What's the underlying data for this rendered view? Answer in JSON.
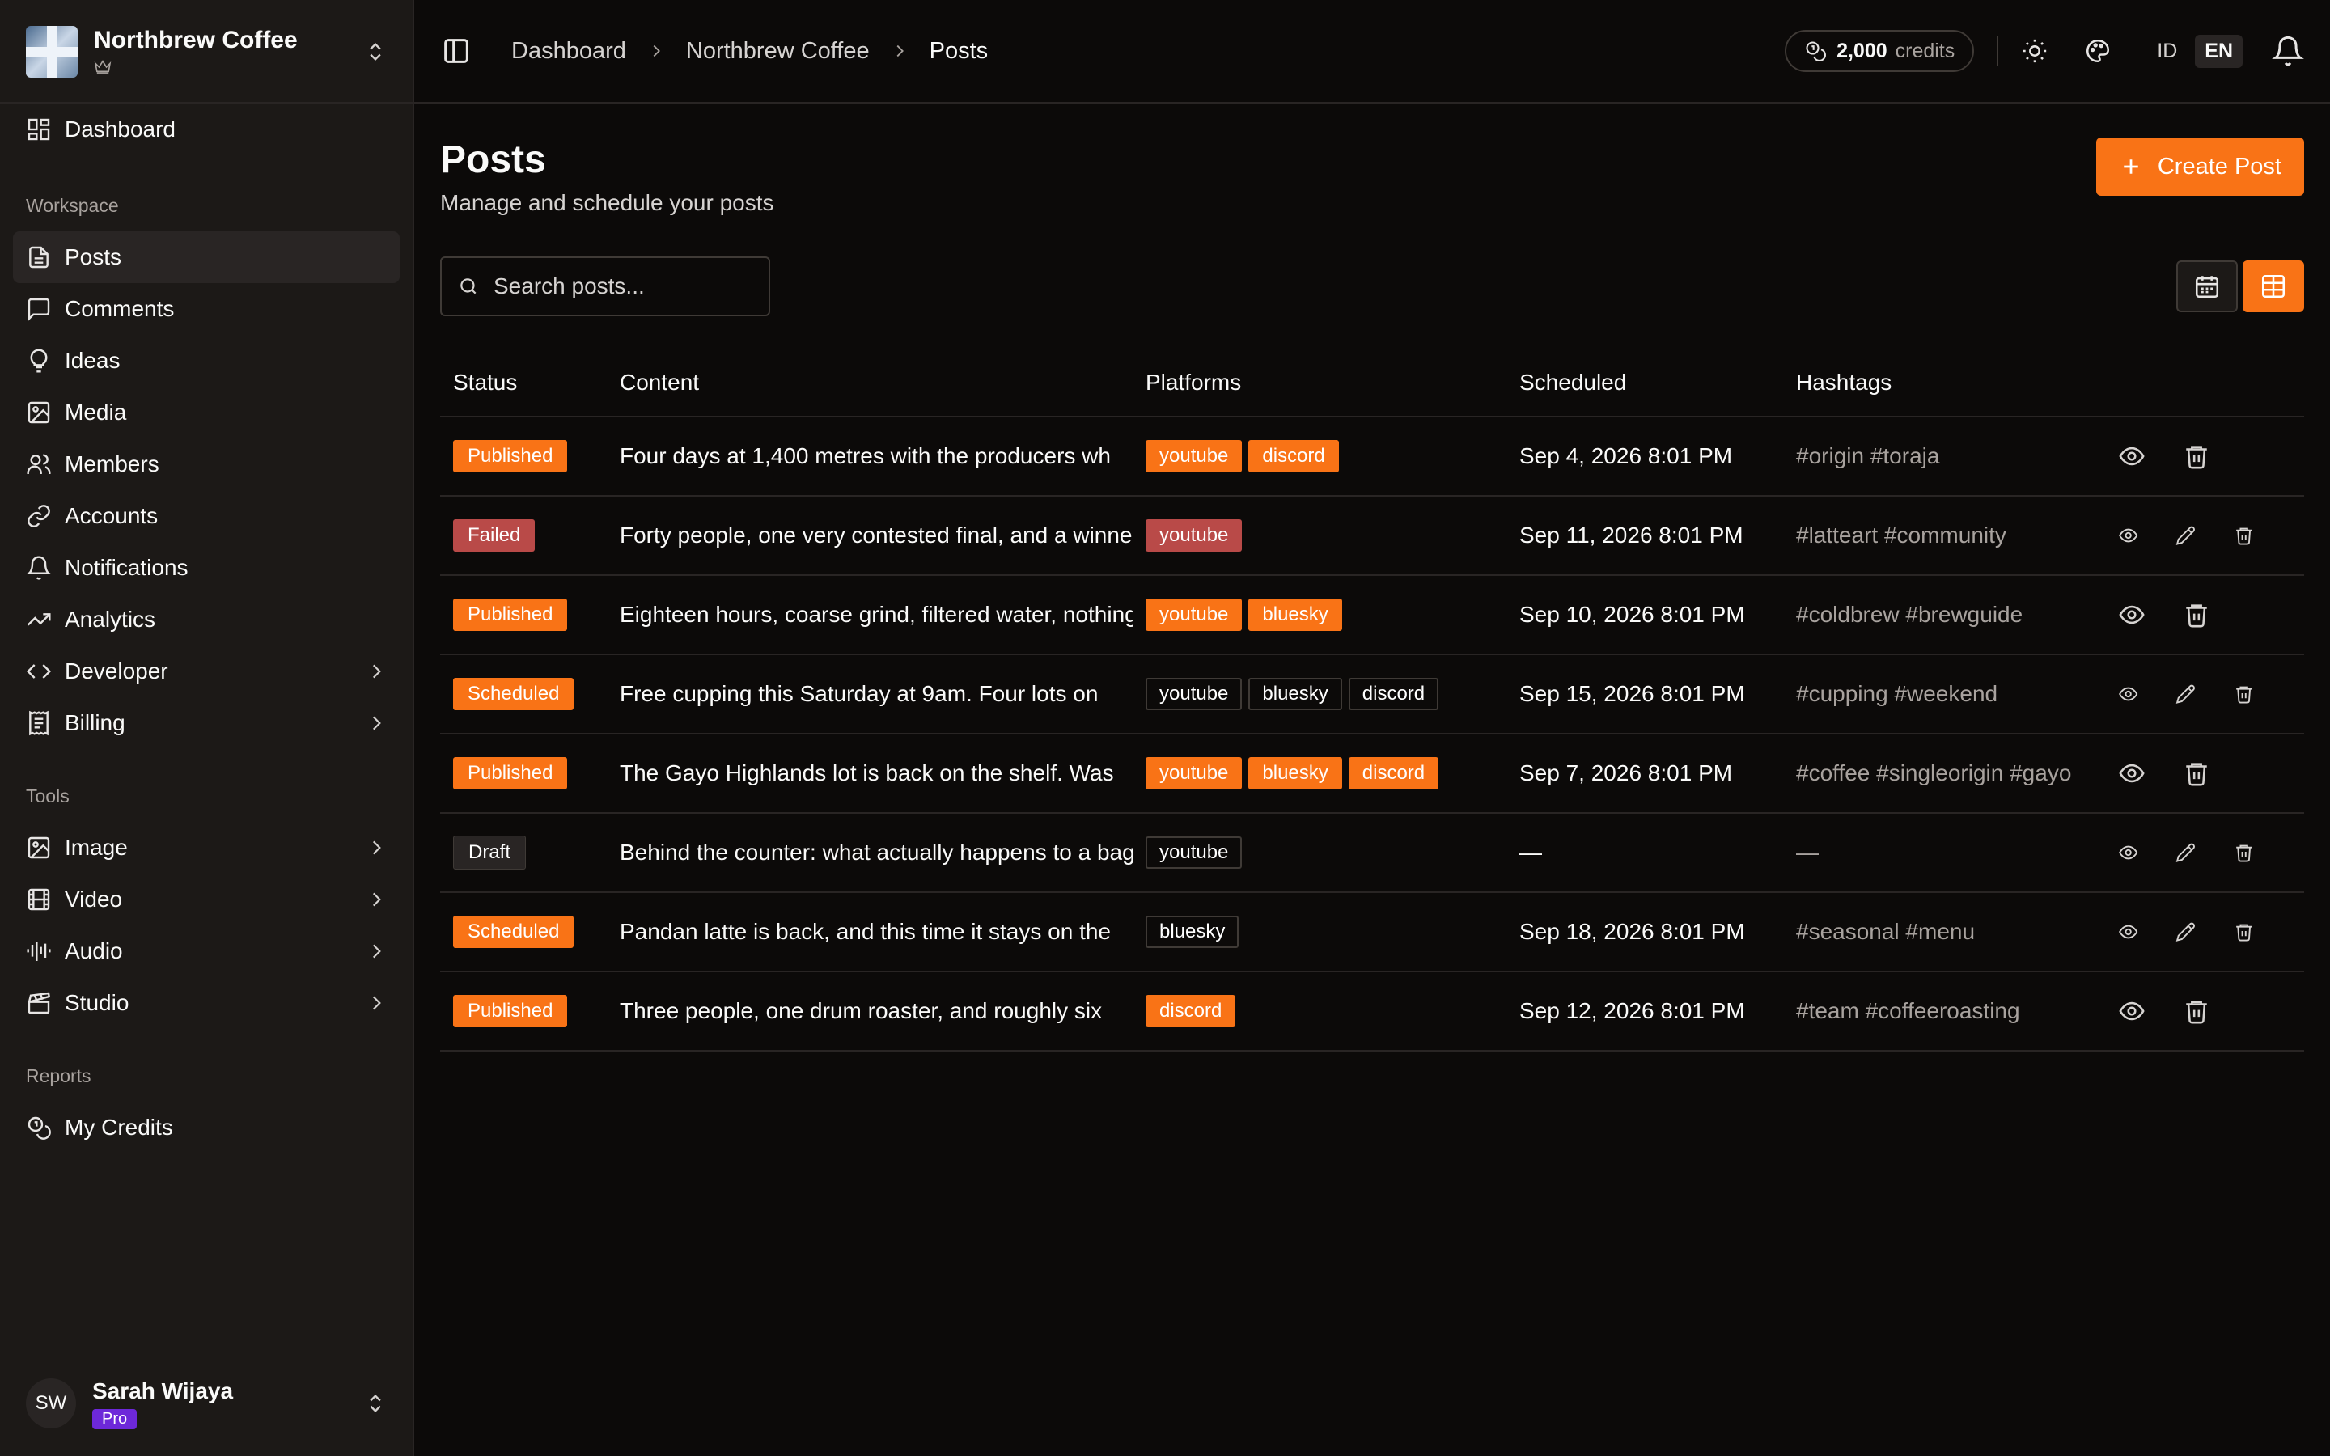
{
  "org": {
    "name": "Northbrew Coffee"
  },
  "sidebar": {
    "dashboard": "Dashboard",
    "workspace_label": "Workspace",
    "workspace_items": [
      {
        "label": "Posts",
        "icon": "file-text-icon",
        "active": true
      },
      {
        "label": "Comments",
        "icon": "message-square-icon"
      },
      {
        "label": "Ideas",
        "icon": "lightbulb-icon"
      },
      {
        "label": "Media",
        "icon": "image-icon"
      },
      {
        "label": "Members",
        "icon": "users-icon"
      },
      {
        "label": "Accounts",
        "icon": "link-icon"
      },
      {
        "label": "Notifications",
        "icon": "bell-icon"
      },
      {
        "label": "Analytics",
        "icon": "trending-up-icon"
      },
      {
        "label": "Developer",
        "icon": "code-icon",
        "expandable": true
      },
      {
        "label": "Billing",
        "icon": "receipt-icon",
        "expandable": true
      }
    ],
    "tools_label": "Tools",
    "tools_items": [
      {
        "label": "Image",
        "icon": "image-icon"
      },
      {
        "label": "Video",
        "icon": "film-icon"
      },
      {
        "label": "Audio",
        "icon": "audio-lines-icon"
      },
      {
        "label": "Studio",
        "icon": "clapperboard-icon"
      }
    ],
    "reports_label": "Reports",
    "reports_items": [
      {
        "label": "My Credits",
        "icon": "coins-icon"
      }
    ]
  },
  "user": {
    "initials": "SW",
    "name": "Sarah Wijaya",
    "plan": "Pro"
  },
  "header": {
    "breadcrumb": [
      "Dashboard",
      "Northbrew Coffee",
      "Posts"
    ],
    "credits_value": "2,000",
    "credits_label": "credits",
    "lang_id": "ID",
    "lang_en": "EN"
  },
  "page": {
    "title": "Posts",
    "subtitle": "Manage and schedule your posts",
    "create_label": "Create Post",
    "search_placeholder": "Search posts..."
  },
  "table": {
    "columns": [
      "Status",
      "Content",
      "Platforms",
      "Scheduled",
      "Hashtags"
    ],
    "rows": [
      {
        "status": "Published",
        "content": "Four days at 1,400 metres with the producers wh",
        "platforms": [
          "youtube",
          "discord"
        ],
        "scheduled": "Sep 4, 2026 8:01 PM",
        "hashtags": "#origin #toraja",
        "editable": false
      },
      {
        "status": "Failed",
        "content": "Forty people, one very contested final, and a winner",
        "platforms": [
          "youtube"
        ],
        "scheduled": "Sep 11, 2026 8:01 PM",
        "hashtags": "#latteart #community",
        "editable": true
      },
      {
        "status": "Published",
        "content": "Eighteen hours, coarse grind, filtered water, nothing",
        "platforms": [
          "youtube",
          "bluesky"
        ],
        "scheduled": "Sep 10, 2026 8:01 PM",
        "hashtags": "#coldbrew #brewguide",
        "editable": false
      },
      {
        "status": "Scheduled",
        "content": "Free cupping this Saturday at 9am. Four lots on",
        "platforms": [
          "youtube",
          "bluesky",
          "discord"
        ],
        "scheduled": "Sep 15, 2026 8:01 PM",
        "hashtags": "#cupping #weekend",
        "editable": true
      },
      {
        "status": "Published",
        "content": "The Gayo Highlands lot is back on the shelf. Was",
        "platforms": [
          "youtube",
          "bluesky",
          "discord"
        ],
        "scheduled": "Sep 7, 2026 8:01 PM",
        "hashtags": "#coffee #singleorigin #gayo",
        "editable": false
      },
      {
        "status": "Draft",
        "content": "Behind the counter: what actually happens to a bag",
        "platforms": [
          "youtube"
        ],
        "scheduled": "—",
        "hashtags": "—",
        "editable": true
      },
      {
        "status": "Scheduled",
        "content": "Pandan latte is back, and this time it stays on the",
        "platforms": [
          "bluesky"
        ],
        "scheduled": "Sep 18, 2026 8:01 PM",
        "hashtags": "#seasonal #menu",
        "editable": true
      },
      {
        "status": "Published",
        "content": "Three people, one drum roaster, and roughly six",
        "platforms": [
          "discord"
        ],
        "scheduled": "Sep 12, 2026 8:01 PM",
        "hashtags": "#team #coffeeroasting",
        "editable": false
      }
    ]
  },
  "colors": {
    "accent": "#f97316",
    "failed": "#b94a48",
    "pro": "#6d28d9"
  }
}
